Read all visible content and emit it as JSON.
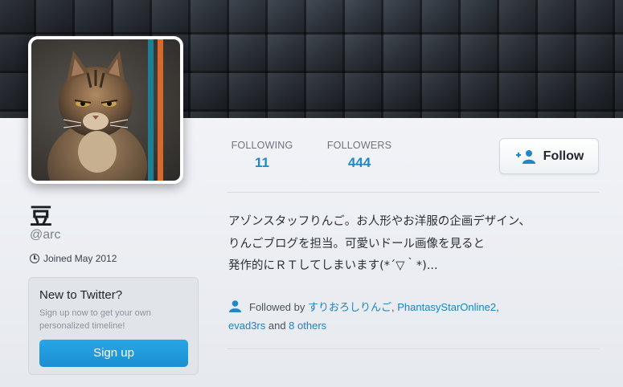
{
  "profile": {
    "name": "豆",
    "handle": "@arc",
    "joined": "Joined May 2012"
  },
  "stats": {
    "following_label": "FOLLOWING",
    "following_count": "11",
    "followers_label": "FOLLOWERS",
    "followers_count": "444"
  },
  "follow_button": {
    "label": "Follow",
    "icon": "add-user-icon"
  },
  "bio": {
    "line1": "アゾンスタッフりんご。お人形やお洋服の企画デザイン、",
    "line2": "りんごブログを担当。可愛いドール画像を見ると",
    "line3": "発作的にＲＴしてしまいます(*´▽｀*)..."
  },
  "followed_by": {
    "icon": "person-icon",
    "prefix": "Followed by ",
    "user1": "すりおろしりんご",
    "sep1": ", ",
    "user2": "PhantasyStarOnline2",
    "sep2": ",",
    "user3": "evad3rs",
    "and": " and ",
    "others": "8 others"
  },
  "signup": {
    "title": "New to Twitter?",
    "text": "Sign up now to get your own personalized timeline!",
    "button": "Sign up"
  },
  "colors": {
    "accent": "#1e88c8",
    "signup_button": "#1b8fd2",
    "card_background": "#eef0f4",
    "banner": "#2a3038"
  },
  "icons": {
    "joined": "clock-icon",
    "avatar": "cat-photo"
  }
}
